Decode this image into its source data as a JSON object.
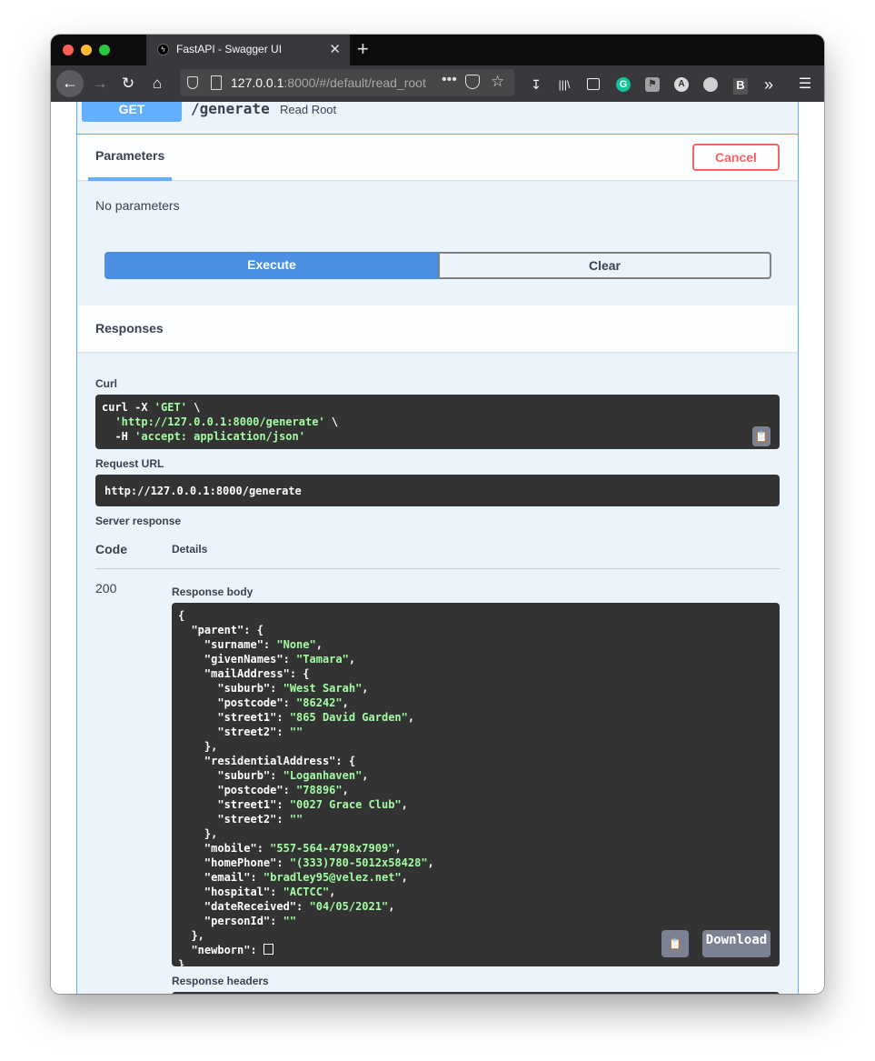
{
  "browser": {
    "tab_title": "FastAPI - Swagger UI",
    "tab_close": "✕",
    "new_tab": "+",
    "url_host": "127.0.0.1",
    "url_rest": ":8000/#/default/read_root",
    "url_more": "•••"
  },
  "operation": {
    "method": "GET",
    "path": "/generate",
    "description": "Read Root"
  },
  "parameters": {
    "tab_label": "Parameters",
    "cancel_label": "Cancel",
    "empty_text": "No parameters",
    "execute_label": "Execute",
    "clear_label": "Clear"
  },
  "responses": {
    "title": "Responses",
    "curl_label": "Curl",
    "curl_lines": [
      [
        "curl -X ",
        "'GET'",
        " \\"
      ],
      [
        "  ",
        "'http://127.0.0.1:8000/generate'",
        " \\"
      ],
      [
        "  -H ",
        "'accept: application/json'",
        ""
      ]
    ],
    "request_url_label": "Request URL",
    "request_url": "http://127.0.0.1:8000/generate",
    "server_response_label": "Server response",
    "code_header": "Code",
    "details_header": "Details",
    "code": "200",
    "response_body_label": "Response body",
    "download_label": "Download",
    "response_headers_label": "Response headers",
    "body_lines": [
      [
        "{",
        "",
        ""
      ],
      [
        "  \"parent\": {",
        "",
        ""
      ],
      [
        "    \"surname\": ",
        "\"None\"",
        ","
      ],
      [
        "    \"givenNames\": ",
        "\"Tamara\"",
        ","
      ],
      [
        "    \"mailAddress\": {",
        "",
        ""
      ],
      [
        "      \"suburb\": ",
        "\"West Sarah\"",
        ","
      ],
      [
        "      \"postcode\": ",
        "\"86242\"",
        ","
      ],
      [
        "      \"street1\": ",
        "\"865 David Garden\"",
        ","
      ],
      [
        "      \"street2\": ",
        "\"\"",
        ""
      ],
      [
        "    },",
        "",
        ""
      ],
      [
        "    \"residentialAddress\": {",
        "",
        ""
      ],
      [
        "      \"suburb\": ",
        "\"Loganhaven\"",
        ","
      ],
      [
        "      \"postcode\": ",
        "\"78896\"",
        ","
      ],
      [
        "      \"street1\": ",
        "\"0027 Grace Club\"",
        ","
      ],
      [
        "      \"street2\": ",
        "\"\"",
        ""
      ],
      [
        "    },",
        "",
        ""
      ],
      [
        "    \"mobile\": ",
        "\"557-564-4798x7909\"",
        ","
      ],
      [
        "    \"homePhone\": ",
        "\"(333)780-5012x58428\"",
        ","
      ],
      [
        "    \"email\": ",
        "\"bradley95@velez.net\"",
        ","
      ],
      [
        "    \"hospital\": ",
        "\"ACTCC\"",
        ","
      ],
      [
        "    \"dateReceived\": ",
        "\"04/05/2021\"",
        ","
      ],
      [
        "    \"personId\": ",
        "\"\"",
        ""
      ],
      [
        "  },",
        "",
        ""
      ],
      [
        "  \"newborn\": ",
        "",
        ""
      ],
      [
        "}",
        "",
        ""
      ]
    ]
  }
}
